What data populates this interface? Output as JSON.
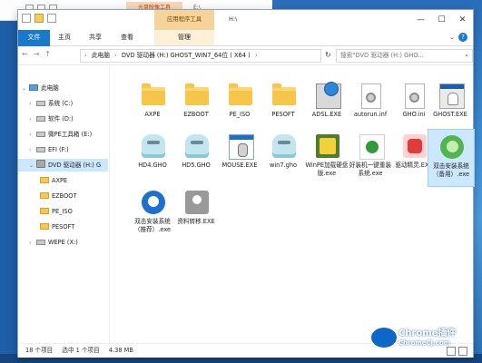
{
  "background_window": {
    "tab_label": "光盘映像工具",
    "path": "E:\\"
  },
  "window": {
    "context_tab": "应用程序工具",
    "title": "H:\\",
    "controls": {
      "minimize": "—",
      "maximize": "☐",
      "close": "✕"
    }
  },
  "ribbon": {
    "tabs": [
      "文件",
      "主页",
      "共享",
      "查看",
      "管理"
    ]
  },
  "nav": {
    "back": "←",
    "forward": "→",
    "up": "↑",
    "breadcrumbs": [
      "此电脑",
      "DVD 驱动器 (H:) GHOST_WIN7_64位 ( X64 )"
    ],
    "search_placeholder": "搜索\"DVD 驱动器 (H:) GHO...",
    "refresh": "↻",
    "search_icon": "⌕"
  },
  "sidebar": {
    "items": [
      {
        "label": "此电脑",
        "icon": "pc"
      },
      {
        "label": "系统 (C:)",
        "icon": "drive"
      },
      {
        "label": "软件 (D:)",
        "icon": "drive"
      },
      {
        "label": "微PE工具箱 (E:)",
        "icon": "drive"
      },
      {
        "label": "EFI (F:)",
        "icon": "drive"
      },
      {
        "label": "DVD 驱动器 (H:) G",
        "icon": "dvd"
      },
      {
        "label": "AXPE",
        "icon": "folder"
      },
      {
        "label": "EZBOOT",
        "icon": "folder"
      },
      {
        "label": "PE_ISO",
        "icon": "folder"
      },
      {
        "label": "PESOFT",
        "icon": "folder"
      },
      {
        "label": "WEPE (X:)",
        "icon": "drive"
      }
    ]
  },
  "files": [
    {
      "name": "AXPE",
      "icon": "folder"
    },
    {
      "name": "EZBOOT",
      "icon": "folder"
    },
    {
      "name": "PE_ISO",
      "icon": "folder"
    },
    {
      "name": "PESOFT",
      "icon": "folder"
    },
    {
      "name": "ADSL.EXE",
      "icon": "adsl"
    },
    {
      "name": "autorun.inf",
      "icon": "doc"
    },
    {
      "name": "GHO.ini",
      "icon": "doc"
    },
    {
      "name": "GHOST.EXE",
      "icon": "ghostexe"
    },
    {
      "name": "HD4.GHO",
      "icon": "ghost"
    },
    {
      "name": "HD5.GHO",
      "icon": "ghost"
    },
    {
      "name": "MOUSE.EXE",
      "icon": "mouse"
    },
    {
      "name": "win7.gho",
      "icon": "ghost"
    },
    {
      "name": "WinPE加载硬盘版.exe",
      "icon": "winpe"
    },
    {
      "name": "好装机一键重装系统.exe",
      "icon": "haozhuang"
    },
    {
      "name": "驱动精灵.EXE",
      "icon": "qudong"
    },
    {
      "name": "双击安装系统（备用）.exe",
      "icon": "install-bak"
    },
    {
      "name": "双击安装系统（推荐）.exe",
      "icon": "install-rec"
    },
    {
      "name": "资料转移.EXE",
      "icon": "ziliao"
    }
  ],
  "status": {
    "count": "18 个项目",
    "selected": "选中 1 个项目",
    "size": "4.38 MB"
  },
  "watermark": {
    "line1": "Chrome插件",
    "line2": "ChromeCJ.com"
  }
}
